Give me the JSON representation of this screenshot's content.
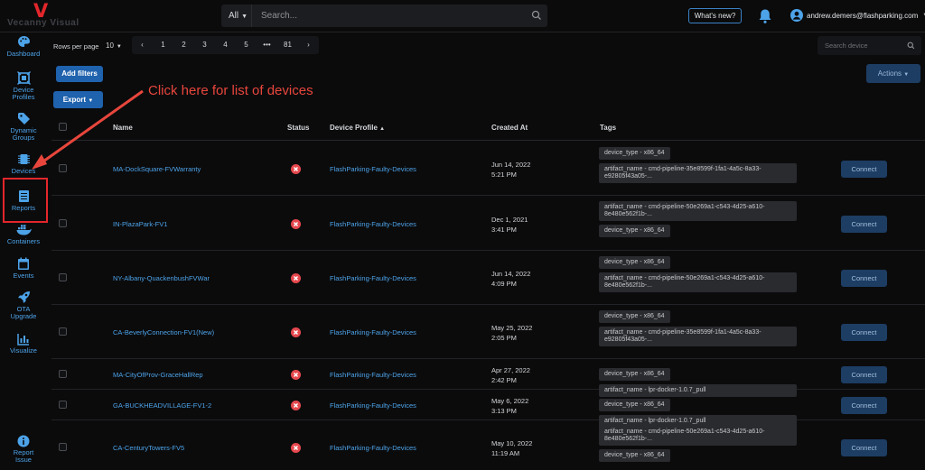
{
  "app": {
    "logo_mark": "V",
    "logo_text": "Vecanny Visual"
  },
  "topbar": {
    "search_scope": "All",
    "search_placeholder": "Search...",
    "whats_new": "What's new?",
    "user_email": "andrew.demers@flashparking.com"
  },
  "sidebar": {
    "items": [
      {
        "label": "Dashboard",
        "icon": "palette-icon"
      },
      {
        "label": "Device Profiles",
        "icon": "device-profile-icon"
      },
      {
        "label": "Dynamic Groups",
        "icon": "tag-icon"
      },
      {
        "label": "Devices",
        "icon": "chip-icon"
      },
      {
        "label": "Reports",
        "icon": "report-icon"
      },
      {
        "label": "Containers",
        "icon": "docker-icon"
      },
      {
        "label": "Events",
        "icon": "calendar-icon"
      },
      {
        "label": "OTA Upgrade",
        "icon": "rocket-icon"
      },
      {
        "label": "Visualize",
        "icon": "chart-icon"
      }
    ],
    "report_issue": "Report Issue"
  },
  "toolbar": {
    "rows_per_page_label": "Rows per page",
    "rows_per_page_value": "10",
    "pages": [
      "‹",
      "1",
      "2",
      "3",
      "4",
      "5",
      "•••",
      "81",
      "›"
    ],
    "device_search_placeholder": "Search device",
    "add_filters": "Add filters",
    "actions": "Actions",
    "export": "Export"
  },
  "annotation": {
    "text": "Click here for list of devices",
    "color": "#e8463c"
  },
  "table": {
    "headers": {
      "name": "Name",
      "status": "Status",
      "profile": "Device Profile",
      "created": "Created At",
      "tags": "Tags"
    },
    "connect_label": "Connect",
    "rows": [
      {
        "name": "MA-DockSquare-FVWarranty",
        "status": "error",
        "profile": "FlashParking-Faulty-Devices",
        "created_date": "Jun 14, 2022",
        "created_time": "5:21 PM",
        "tags": [
          "device_type - x86_64",
          "artifact_name - cmd-pipeline-35e8599f-1fa1-4a5c-8a33-e92805f43a05-..."
        ]
      },
      {
        "name": "IN-PlazaPark-FV1",
        "status": "error",
        "profile": "FlashParking-Faulty-Devices",
        "created_date": "Dec 1, 2021",
        "created_time": "3:41 PM",
        "tags": [
          "artifact_name - cmd-pipeline-50e269a1-c543-4d25-a610-8e480e562f1b-...",
          "device_type - x86_64"
        ]
      },
      {
        "name": "NY-Albany-QuackenbushFVWar",
        "status": "error",
        "profile": "FlashParking-Faulty-Devices",
        "created_date": "Jun 14, 2022",
        "created_time": "4:09 PM",
        "tags": [
          "device_type - x86_64",
          "artifact_name - cmd-pipeline-50e269a1-c543-4d25-a610-8e480e562f1b-..."
        ]
      },
      {
        "name": "CA-BeverlyConnection-FV1(New)",
        "status": "error",
        "profile": "FlashParking-Faulty-Devices",
        "created_date": "May 25, 2022",
        "created_time": "2:05 PM",
        "tags": [
          "device_type - x86_64",
          "artifact_name - cmd-pipeline-35e8599f-1fa1-4a5c-8a33-e92805f43a05-..."
        ]
      },
      {
        "name": "MA-CityOfProv-GraceHallRep",
        "status": "error",
        "profile": "FlashParking-Faulty-Devices",
        "created_date": "Apr 27, 2022",
        "created_time": "2:42 PM",
        "tags": [
          "device_type - x86_64",
          "artifact_name - lpr-docker-1.0.7_pull"
        ]
      },
      {
        "name": "GA-BUCKHEADVILLAGE-FV1-2",
        "status": "error",
        "profile": "FlashParking-Faulty-Devices",
        "created_date": "May 6, 2022",
        "created_time": "3:13 PM",
        "tags": [
          "device_type - x86_64",
          "artifact_name - lpr-docker-1.0.7_pull"
        ]
      },
      {
        "name": "CA-CenturyTowers-FV5",
        "status": "error",
        "profile": "FlashParking-Faulty-Devices",
        "created_date": "May 10, 2022",
        "created_time": "11:19 AM",
        "tags": [
          "artifact_name - cmd-pipeline-50e269a1-c543-4d25-a610-8e480e562f1b-...",
          "device_type - x86_64"
        ]
      }
    ]
  },
  "colors": {
    "accent": "#4da3e8",
    "primary_button": "#1f62ad",
    "error": "#e5484d",
    "highlight": "#e3262b"
  }
}
